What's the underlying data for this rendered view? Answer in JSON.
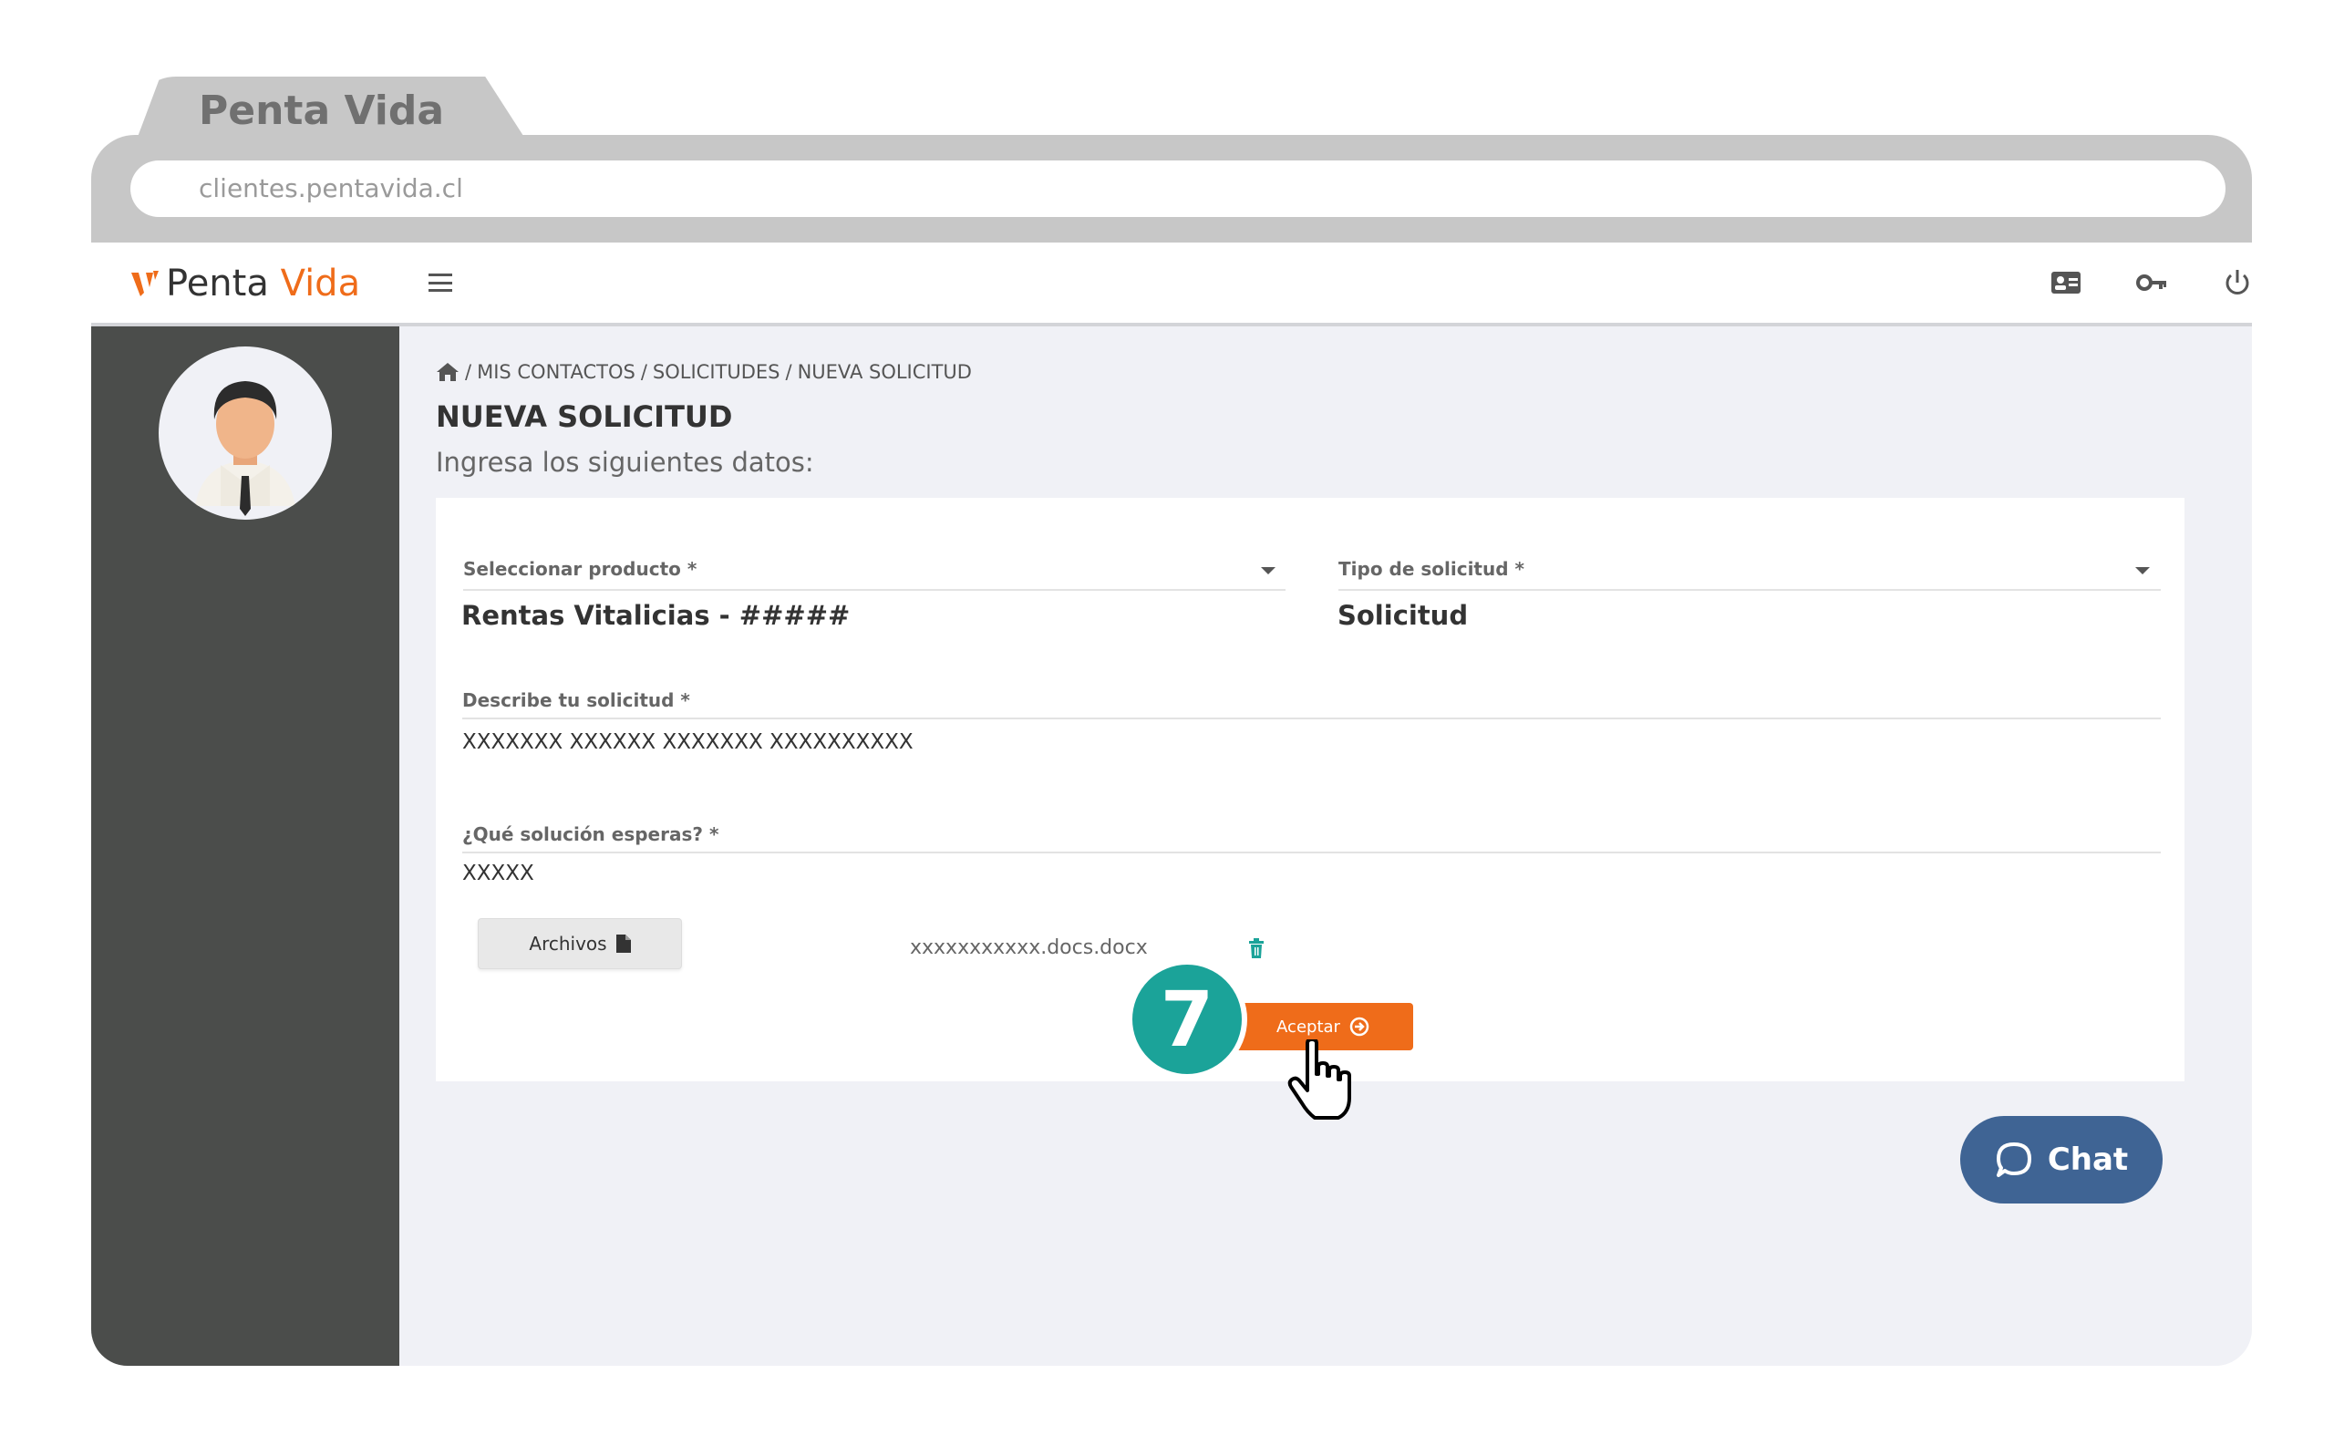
{
  "browser": {
    "tab_title": "Penta Vida",
    "url": "clientes.pentavida.cl"
  },
  "header": {
    "logo_text_part1": "Penta",
    "logo_text_part2": "Vida",
    "brand_color": "#ef6c1a"
  },
  "breadcrumb": {
    "items": [
      "MIS CONTACTOS",
      "SOLICITUDES",
      "NUEVA SOLICITUD"
    ],
    "separator": "/"
  },
  "page": {
    "title": "NUEVA SOLICITUD",
    "subtitle": "Ingresa los siguientes datos:"
  },
  "form": {
    "producto": {
      "label": "Seleccionar producto *",
      "value": "Rentas Vitalicias - #####"
    },
    "tipo": {
      "label": "Tipo de solicitud *",
      "value": "Solicitud"
    },
    "describe": {
      "label": "Describe tu solicitud *",
      "value": "XXXXXXX XXXXXX XXXXXXX XXXXXXXXXX"
    },
    "solucion": {
      "label": "¿Qué solución esperas? *",
      "value": "XXXXX"
    },
    "archivos_label": "Archivos",
    "file_name": "xxxxxxxxxxx.docs.docx",
    "aceptar_label": "Aceptar"
  },
  "step_badge": "7",
  "chat": {
    "label": "Chat",
    "color": "#3f6494"
  }
}
